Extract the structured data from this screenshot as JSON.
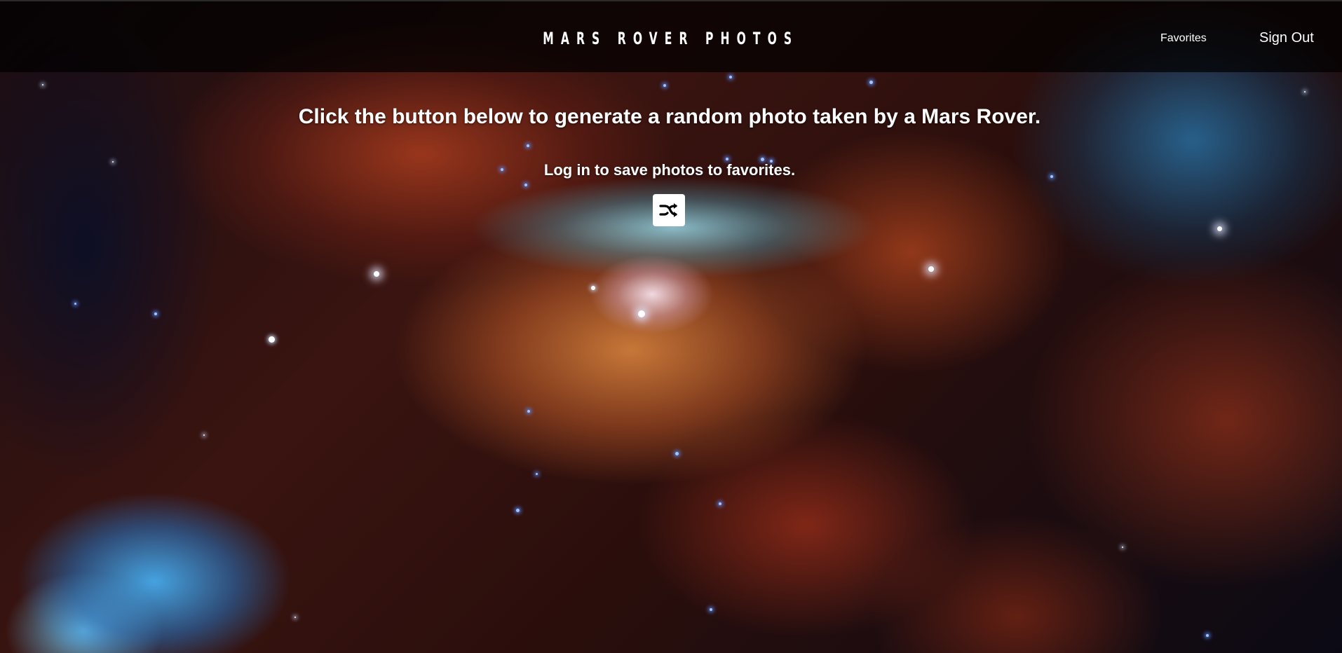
{
  "header": {
    "brand": "MARS ROVER PHOTOS",
    "nav": {
      "favorites": "Favorites",
      "sign_out": "Sign Out"
    }
  },
  "main": {
    "headline": "Click the button below to generate a random photo taken by a Mars Rover.",
    "subline": "Log in to save photos to favorites.",
    "shuffle_button": {
      "icon": "shuffle-icon"
    }
  },
  "background": {
    "description_icon": "nebula-background",
    "colors": {
      "header_bg": "#000000",
      "text": "#ffffff",
      "button_bg": "#ffffff",
      "icon": "#000000"
    }
  }
}
